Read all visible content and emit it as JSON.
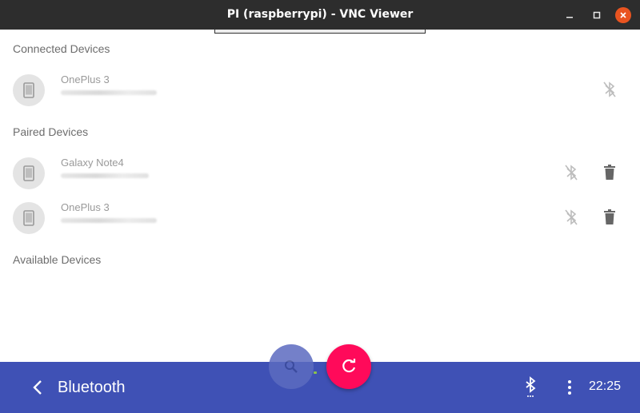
{
  "window": {
    "title": "PI (raspberrypi) - VNC Viewer",
    "close_color": "#e95420"
  },
  "sections": {
    "connected": "Connected Devices",
    "paired": "Paired Devices",
    "available": "Available Devices"
  },
  "connected_devices": [
    {
      "name": "OnePlus 3",
      "icon": "phone-icon",
      "actions": [
        "bluetooth-disconnected-icon"
      ]
    }
  ],
  "paired_devices": [
    {
      "name": "Galaxy Note4",
      "icon": "phone-icon",
      "actions": [
        "bluetooth-disconnected-icon",
        "delete-icon"
      ]
    },
    {
      "name": "OnePlus 3",
      "icon": "phone-icon",
      "actions": [
        "bluetooth-disconnected-icon",
        "delete-icon"
      ]
    }
  ],
  "bottom_bar": {
    "title": "Bluetooth",
    "clock": "22:25",
    "color": "#3f51b5"
  },
  "fabs": {
    "search_icon": "search-icon",
    "refresh_icon": "refresh-icon",
    "refresh_color": "#ff0a5a"
  }
}
